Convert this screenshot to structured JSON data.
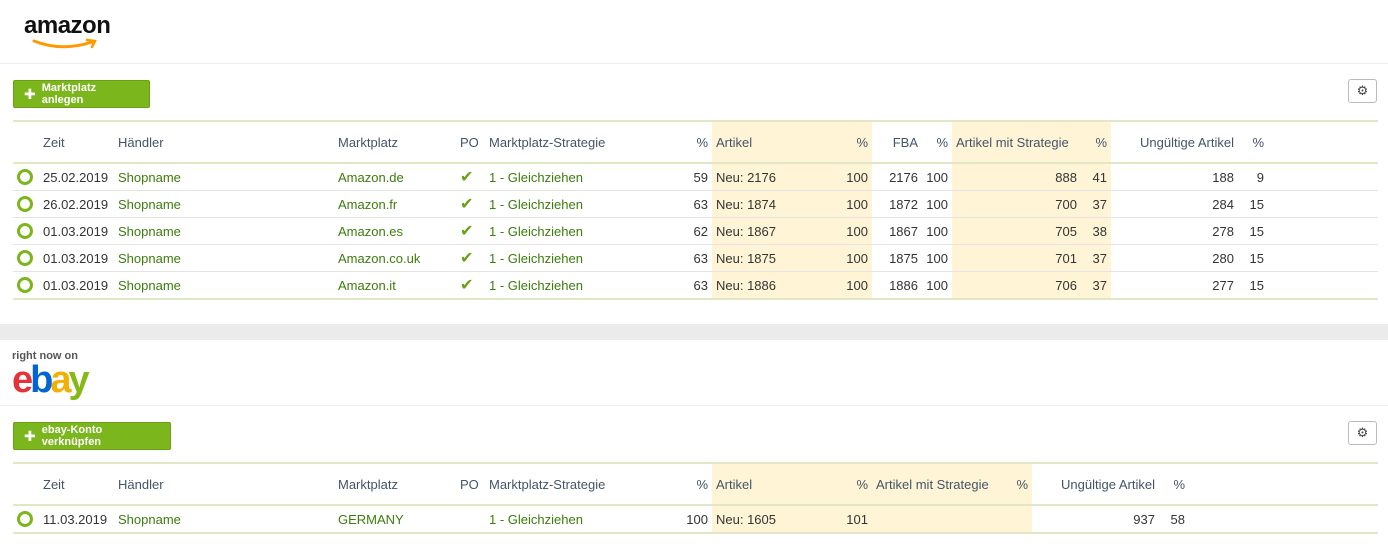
{
  "amazon": {
    "logo_text": "amazon",
    "add_button": "Marktplatz anlegen",
    "columns": [
      "Zeit",
      "Händler",
      "Marktplatz",
      "PO",
      "Marktplatz-Strategie",
      "%",
      "Artikel",
      "%",
      "FBA",
      "%",
      "Artikel mit Strategie",
      "%",
      "Ungültige Artikel",
      "%"
    ],
    "rows": [
      {
        "zeit": "25.02.2019",
        "haendler": "Shopname",
        "marktplatz": "Amazon.de",
        "strategie": "1 - Gleichziehen",
        "p1": "59",
        "artikel": "Neu: 2176",
        "p2": "100",
        "fba": "2176",
        "p3": "100",
        "mit": "888",
        "p4": "41",
        "ung": "188",
        "p5": "9"
      },
      {
        "zeit": "26.02.2019",
        "haendler": "Shopname",
        "marktplatz": "Amazon.fr",
        "strategie": "1 - Gleichziehen",
        "p1": "63",
        "artikel": "Neu: 1874",
        "p2": "100",
        "fba": "1872",
        "p3": "100",
        "mit": "700",
        "p4": "37",
        "ung": "284",
        "p5": "15"
      },
      {
        "zeit": "01.03.2019",
        "haendler": "Shopname",
        "marktplatz": "Amazon.es",
        "strategie": "1 - Gleichziehen",
        "p1": "62",
        "artikel": "Neu: 1867",
        "p2": "100",
        "fba": "1867",
        "p3": "100",
        "mit": "705",
        "p4": "38",
        "ung": "278",
        "p5": "15"
      },
      {
        "zeit": "01.03.2019",
        "haendler": "Shopname",
        "marktplatz": "Amazon.co.uk",
        "strategie": "1 - Gleichziehen",
        "p1": "63",
        "artikel": "Neu: 1875",
        "p2": "100",
        "fba": "1875",
        "p3": "100",
        "mit": "701",
        "p4": "37",
        "ung": "280",
        "p5": "15"
      },
      {
        "zeit": "01.03.2019",
        "haendler": "Shopname",
        "marktplatz": "Amazon.it",
        "strategie": "1 - Gleichziehen",
        "p1": "63",
        "artikel": "Neu: 1886",
        "p2": "100",
        "fba": "1886",
        "p3": "100",
        "mit": "706",
        "p4": "37",
        "ung": "277",
        "p5": "15"
      }
    ]
  },
  "ebay": {
    "tagline": "right now on",
    "logo_letters": [
      "e",
      "b",
      "a",
      "y"
    ],
    "logo_colors": [
      "#e53238",
      "#0064d2",
      "#f5af02",
      "#86b817"
    ],
    "add_button": "ebay-Konto verknüpfen",
    "columns": [
      "Zeit",
      "Händler",
      "Marktplatz",
      "PO",
      "Marktplatz-Strategie",
      "%",
      "Artikel",
      "%",
      "Artikel mit Strategie",
      "%",
      "Ungültige Artikel",
      "%"
    ],
    "rows": [
      {
        "zeit": "11.03.2019",
        "haendler": "Shopname",
        "marktplatz": "GERMANY",
        "strategie": "1 - Gleichziehen",
        "p1": "100",
        "artikel": "Neu: 1605",
        "p2": "101",
        "mit": "",
        "p4": "",
        "ung": "937",
        "p5": "58"
      }
    ]
  },
  "icons": {
    "add": "plus-icon",
    "settings": "gear-icon",
    "status": "circle-status-icon",
    "po": "checkmark-icon"
  },
  "colors": {
    "accent": "#7cb61d",
    "highlight": "#fff5d6",
    "link": "#3d7c0d"
  }
}
